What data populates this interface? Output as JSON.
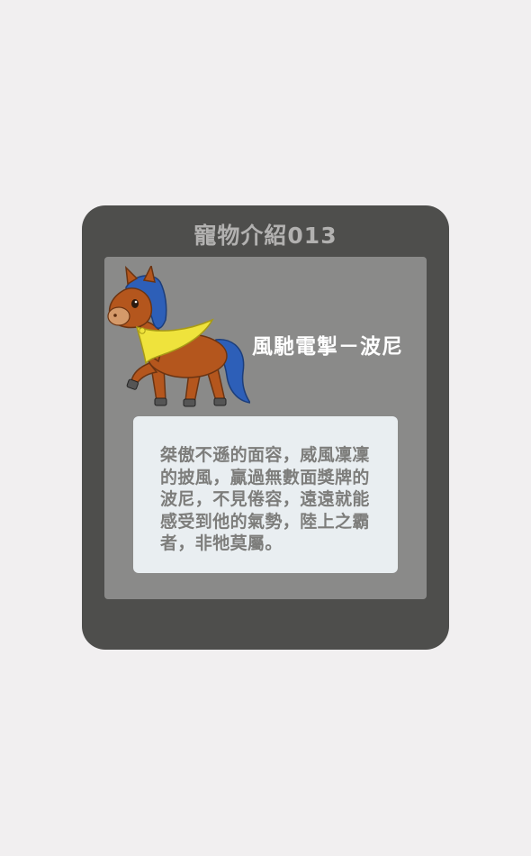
{
  "card": {
    "title": "寵物介紹013"
  },
  "pet": {
    "name": "風馳電掣－波尼",
    "image_icon": "horse-with-yellow-cape-illustration",
    "description": "桀傲不遜的面容，威風凜凜的披風，贏過無數面獎牌的波尼，不見倦容，遠遠就能感受到他的氣勢，陸上之霸者，非牠莫屬。"
  },
  "colors": {
    "page_background": "#f1eff0",
    "card_background": "#4e4e4c",
    "title_text": "#b2b1b0",
    "inner_panel": "#8a8a89",
    "name_text": "#ffffff",
    "description_box": "#e9eef1",
    "description_text": "#7d7d7b"
  }
}
